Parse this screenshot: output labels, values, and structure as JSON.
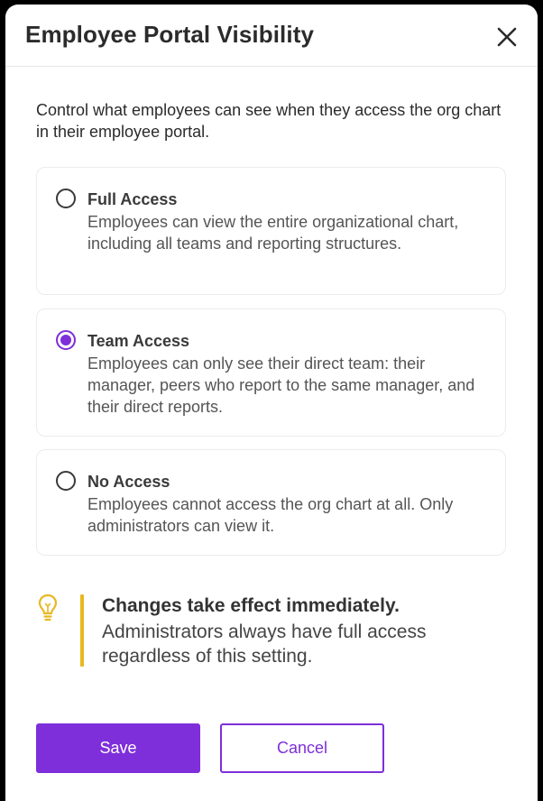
{
  "dialog": {
    "title": "Employee Portal Visibility",
    "close_icon": "close-icon",
    "intro": "Control what employees can see when they access the org chart in their employee portal.",
    "selected_option": "team",
    "options": [
      {
        "id": "full",
        "title": "Full Access",
        "description": "Employees can view the entire organizational chart, including all teams and reporting structures.",
        "checked": false
      },
      {
        "id": "team",
        "title": "Team Access",
        "description": "Employees can only see their direct team: their manager, peers who report to the same manager, and their direct reports.",
        "checked": true
      },
      {
        "id": "none",
        "title": "No Access",
        "description": "Employees cannot access the org chart at all. Only administrators can view it.",
        "checked": false
      }
    ],
    "notice": {
      "icon": "lightbulb-icon",
      "title": "Changes take effect immediately.",
      "text": "Administrators always have full access regardless of this setting."
    },
    "buttons": {
      "save_label": "Save",
      "cancel_label": "Cancel"
    }
  },
  "colors": {
    "accent": "#7e2fd9",
    "notice_bar": "#e8b820",
    "bulb": "#e8b820"
  }
}
